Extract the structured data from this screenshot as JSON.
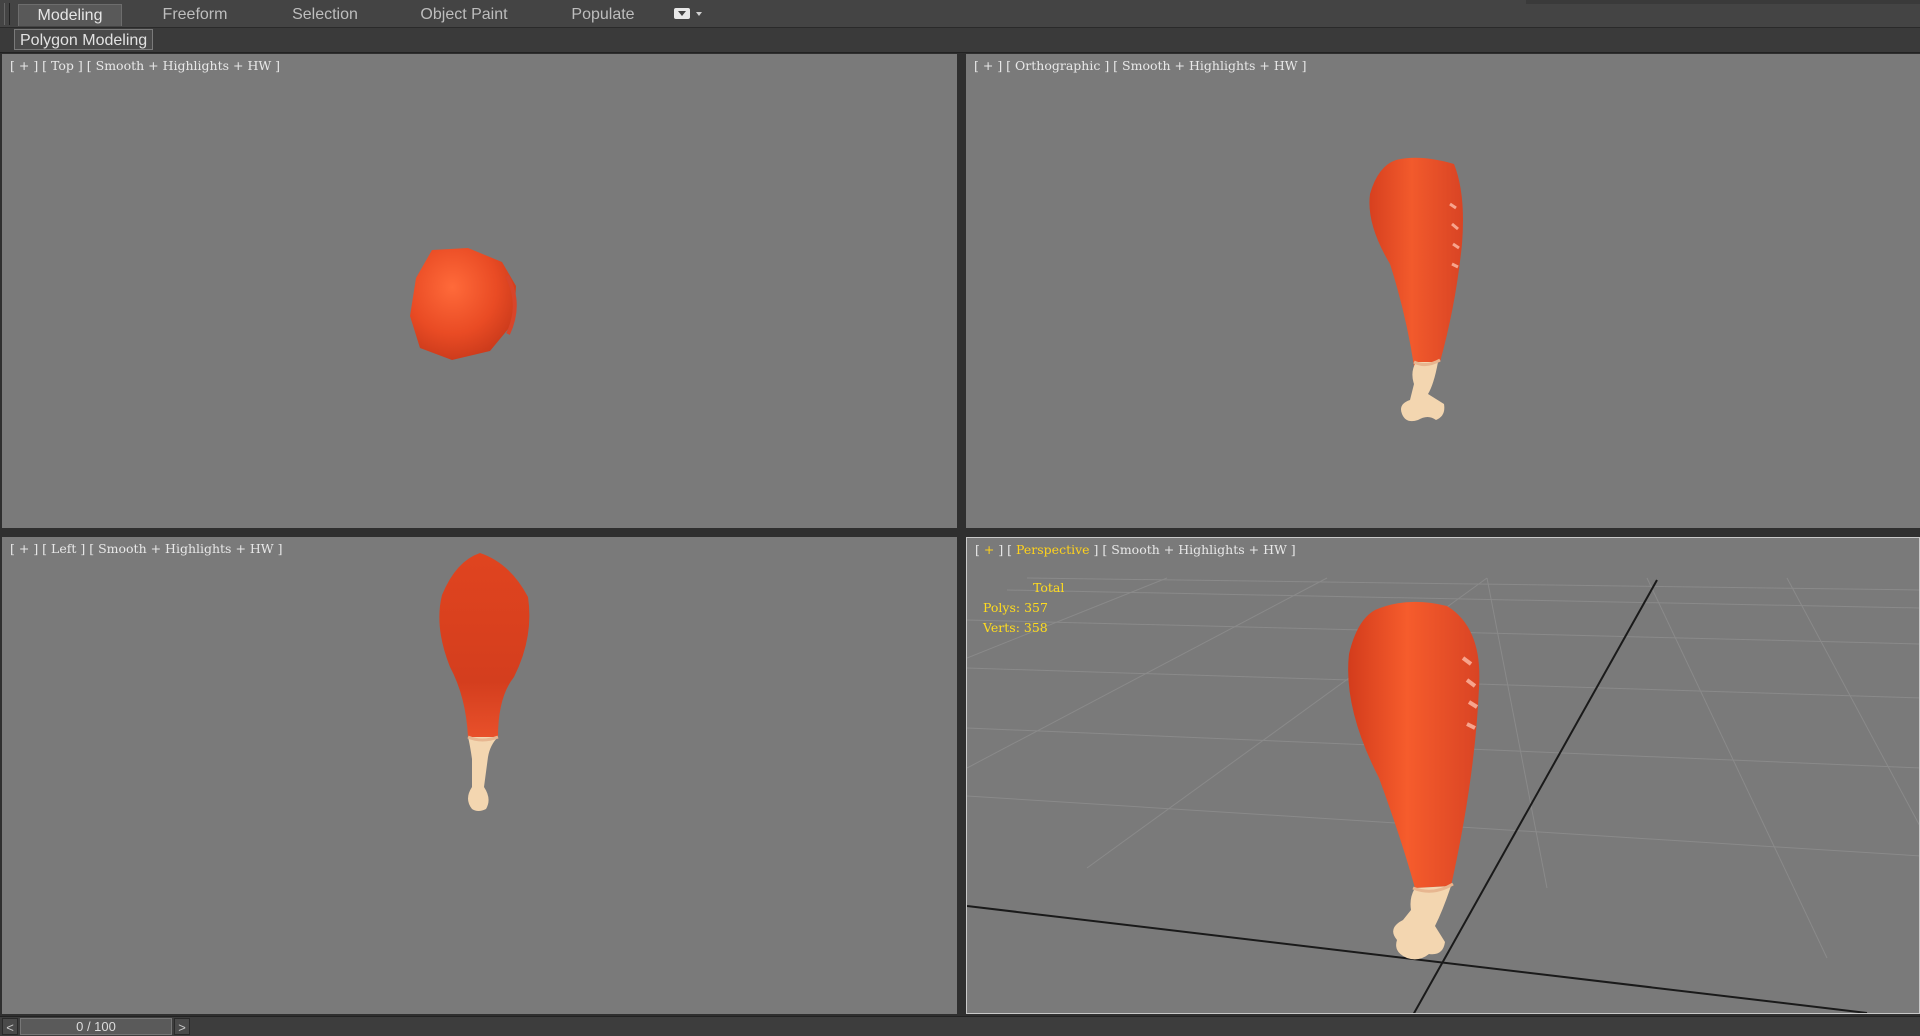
{
  "ribbon": {
    "tabs": [
      {
        "label": "Modeling",
        "active": true
      },
      {
        "label": "Freeform",
        "active": false
      },
      {
        "label": "Selection",
        "active": false
      },
      {
        "label": "Object Paint",
        "active": false
      },
      {
        "label": "Populate",
        "active": false
      }
    ],
    "toggle_icon": "ribbon-minimize-toggle-icon"
  },
  "subbar": {
    "panel_label": "Polygon Modeling"
  },
  "viewports": {
    "top": {
      "open": "[ ",
      "plus": "+",
      "sep1": " ] [ ",
      "view": "Top",
      "sep2": " ] [ ",
      "shading": "Smooth + Highlights + HW",
      "close": " ]"
    },
    "ortho": {
      "open": "[ ",
      "plus": "+",
      "sep1": " ] [ ",
      "view": "Orthographic",
      "sep2": " ] [ ",
      "shading": "Smooth + Highlights + HW",
      "close": " ]"
    },
    "left": {
      "open": "[ ",
      "plus": "+",
      "sep1": " ] [ ",
      "view": "Left",
      "sep2": " ] [ ",
      "shading": "Smooth + Highlights + HW",
      "close": " ]"
    },
    "perspective": {
      "open": "[ ",
      "plus": "+",
      "sep1": " ] [ ",
      "view": "Perspective",
      "sep2": " ] [ ",
      "shading": "Smooth + Highlights + HW",
      "close": " ]"
    }
  },
  "stats": {
    "header": "Total",
    "polys": "Polys: 357",
    "verts": "Verts: 358"
  },
  "timebar": {
    "prev": "<",
    "frame": "0 / 100",
    "next": ">"
  },
  "colors": {
    "viewport_bg": "#7a7a7a",
    "meat": "#e94b24",
    "bone": "#f3d6b0",
    "label_highlight": "#ffd21c",
    "stats_text": "#ffdc1e"
  }
}
